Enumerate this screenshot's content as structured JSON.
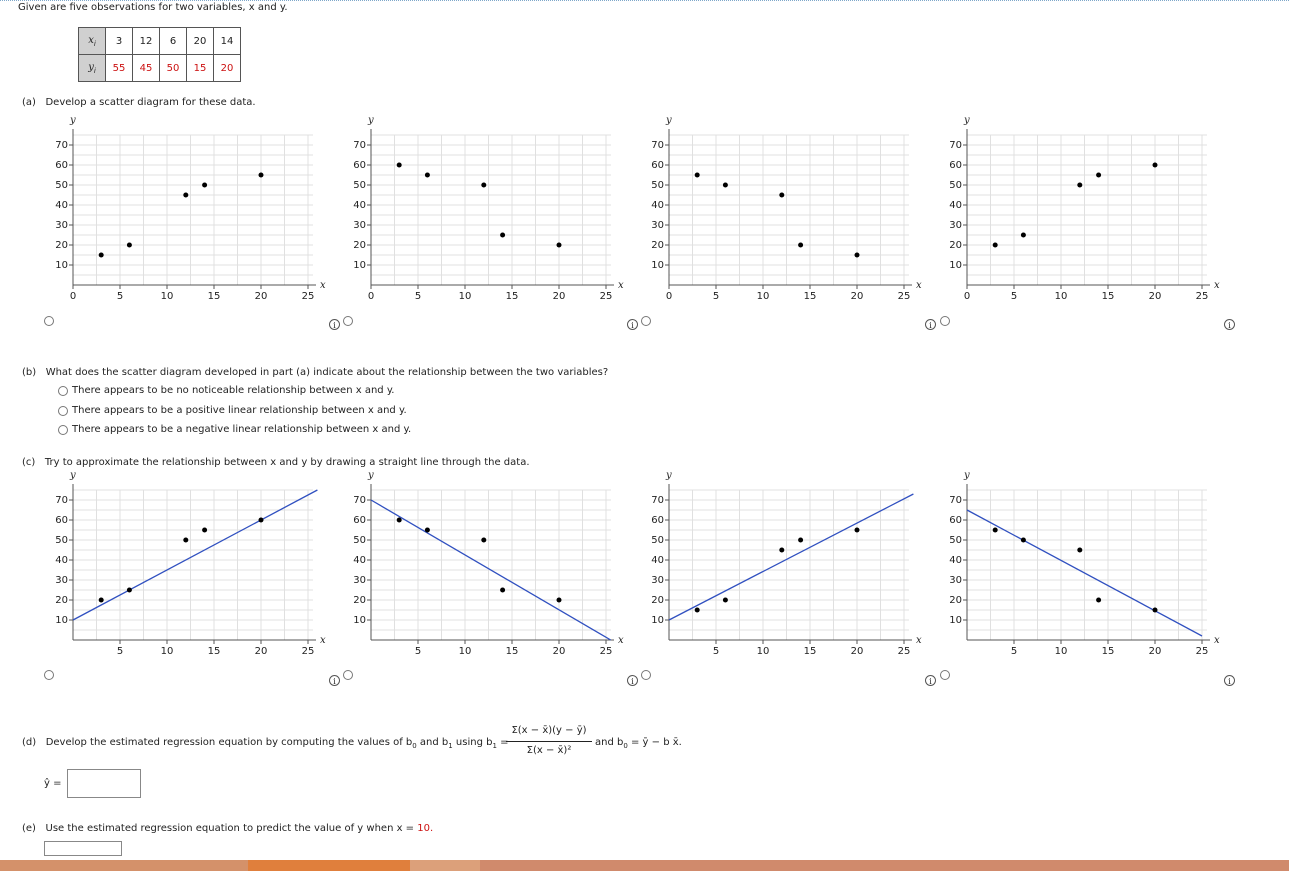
{
  "intro": "Given are five observations for two variables, x and y.",
  "table": {
    "x_header": "x",
    "x_sub": "i",
    "y_header": "y",
    "y_sub": "i",
    "x": [
      "3",
      "12",
      "6",
      "20",
      "14"
    ],
    "y": [
      "55",
      "45",
      "50",
      "15",
      "20"
    ]
  },
  "part_a": {
    "label": "(a)",
    "text": "Develop a scatter diagram for these data."
  },
  "part_b": {
    "label": "(b)",
    "text": "What does the scatter diagram developed in part (a) indicate about the relationship between the two variables?",
    "options": [
      "There appears to be no noticeable relationship between x and y.",
      "There appears to be a positive linear relationship between x and y.",
      "There appears to be a negative linear relationship between x and y."
    ]
  },
  "part_c": {
    "label": "(c)",
    "text": "Try to approximate the relationship between x and y by drawing a straight line through the data."
  },
  "part_d": {
    "label": "(d)",
    "text": "Develop the estimated regression equation by computing the values of b",
    "text_mid": "and b",
    "text_using": "using b",
    "eq": "=",
    "numerator": "Σ(x  − x̄)(y  − ȳ)",
    "denominator": "Σ(x  − x̄)²",
    "and_b0": "and b",
    "b0_formula": "= ȳ − b x̄.",
    "yhat_label": "ŷ ="
  },
  "part_e": {
    "label": "(e)",
    "text": "Use the estimated regression equation to predict the value of y when x =",
    "x_value": "10."
  },
  "info_glyph": "i",
  "axis_labels": {
    "x": "x",
    "y": "y"
  },
  "colors": {
    "accent_red": "#cc1111",
    "line_blue": "#3050c0",
    "footer": [
      "#e07f3c",
      "#e88c4c",
      "#dca07a",
      "#d9a48b"
    ]
  },
  "chart_data": [
    {
      "type": "scatter",
      "xlabel": "x",
      "ylabel": "y",
      "xlim": [
        0,
        25
      ],
      "ylim": [
        0,
        70
      ],
      "xticks": [
        0,
        5,
        10,
        15,
        20,
        25
      ],
      "yticks": [
        10,
        20,
        30,
        40,
        50,
        60,
        70
      ],
      "x": [
        3,
        6,
        12,
        14,
        20
      ],
      "y": [
        15,
        20,
        45,
        50,
        55
      ]
    },
    {
      "type": "scatter",
      "xlabel": "x",
      "ylabel": "y",
      "xlim": [
        0,
        25
      ],
      "ylim": [
        0,
        70
      ],
      "xticks": [
        0,
        5,
        10,
        15,
        20,
        25
      ],
      "yticks": [
        10,
        20,
        30,
        40,
        50,
        60,
        70
      ],
      "x": [
        3,
        6,
        12,
        14,
        20
      ],
      "y": [
        60,
        55,
        50,
        25,
        20
      ]
    },
    {
      "type": "scatter",
      "xlabel": "x",
      "ylabel": "y",
      "xlim": [
        0,
        25
      ],
      "ylim": [
        0,
        70
      ],
      "xticks": [
        0,
        5,
        10,
        15,
        20,
        25
      ],
      "yticks": [
        10,
        20,
        30,
        40,
        50,
        60,
        70
      ],
      "x": [
        3,
        6,
        12,
        14,
        20
      ],
      "y": [
        55,
        50,
        45,
        20,
        15
      ]
    },
    {
      "type": "scatter",
      "xlabel": "x",
      "ylabel": "y",
      "xlim": [
        0,
        25
      ],
      "ylim": [
        0,
        70
      ],
      "xticks": [
        0,
        5,
        10,
        15,
        20,
        25
      ],
      "yticks": [
        10,
        20,
        30,
        40,
        50,
        60,
        70
      ],
      "x": [
        3,
        6,
        12,
        14,
        20
      ],
      "y": [
        20,
        25,
        50,
        55,
        60
      ]
    },
    {
      "type": "scatter",
      "xlabel": "x",
      "ylabel": "y",
      "xlim": [
        0,
        25
      ],
      "ylim": [
        0,
        70
      ],
      "xticks": [
        5,
        10,
        15,
        20,
        25
      ],
      "yticks": [
        10,
        20,
        30,
        40,
        50,
        60,
        70
      ],
      "x": [
        3,
        6,
        12,
        14,
        20
      ],
      "y": [
        20,
        25,
        50,
        55,
        60
      ],
      "line": {
        "x": [
          0,
          26
        ],
        "y": [
          10,
          75
        ]
      }
    },
    {
      "type": "scatter",
      "xlabel": "x",
      "ylabel": "y",
      "xlim": [
        0,
        25
      ],
      "ylim": [
        0,
        70
      ],
      "xticks": [
        5,
        10,
        15,
        20,
        25
      ],
      "yticks": [
        10,
        20,
        30,
        40,
        50,
        60,
        70
      ],
      "x": [
        3,
        6,
        12,
        14,
        20
      ],
      "y": [
        60,
        55,
        50,
        25,
        20
      ],
      "line": {
        "x": [
          0,
          25.5
        ],
        "y": [
          70,
          0
        ]
      }
    },
    {
      "type": "scatter",
      "xlabel": "x",
      "ylabel": "y",
      "xlim": [
        0,
        25
      ],
      "ylim": [
        0,
        70
      ],
      "xticks": [
        5,
        10,
        15,
        20,
        25
      ],
      "yticks": [
        10,
        20,
        30,
        40,
        50,
        60,
        70
      ],
      "x": [
        3,
        6,
        12,
        14,
        20
      ],
      "y": [
        15,
        20,
        45,
        50,
        55
      ],
      "line": {
        "x": [
          0,
          26
        ],
        "y": [
          10,
          73
        ]
      }
    },
    {
      "type": "scatter",
      "xlabel": "x",
      "ylabel": "y",
      "xlim": [
        0,
        25
      ],
      "ylim": [
        0,
        70
      ],
      "xticks": [
        5,
        10,
        15,
        20,
        25
      ],
      "yticks": [
        10,
        20,
        30,
        40,
        50,
        60,
        70
      ],
      "x": [
        3,
        6,
        12,
        14,
        20
      ],
      "y": [
        55,
        50,
        45,
        20,
        15
      ],
      "line": {
        "x": [
          0,
          25
        ],
        "y": [
          65,
          2
        ]
      }
    }
  ]
}
